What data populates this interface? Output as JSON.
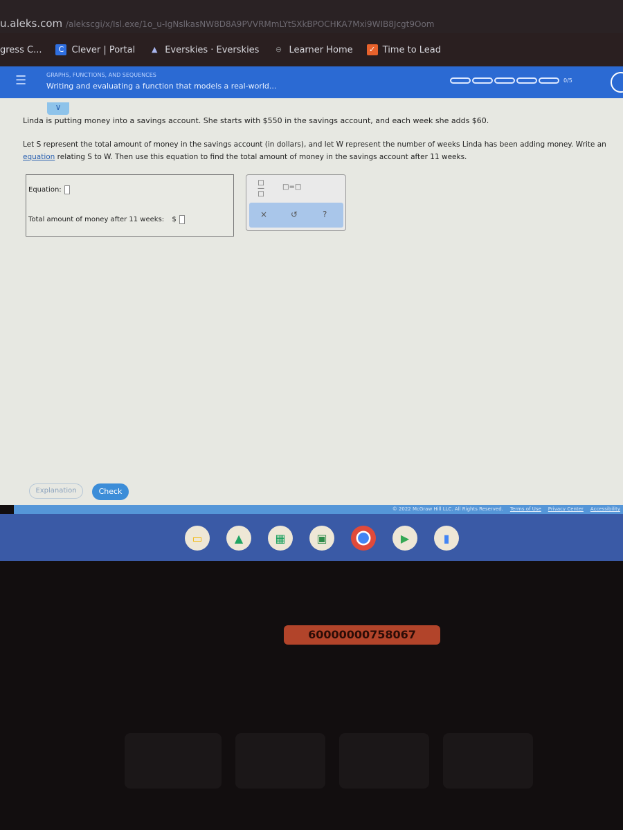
{
  "browser": {
    "url_domain": "u.aleks.com",
    "url_rest": "/alekscgi/x/Isl.exe/1o_u-IgNslkasNW8D8A9PVVRMmLYtSXkBPOCHKA7Mxi9WIB8Jcgt9Oom",
    "bookmarks": [
      {
        "label": "gress C...",
        "icon": "progress-icon"
      },
      {
        "label": "Clever | Portal",
        "icon": "clever-icon"
      },
      {
        "label": "Everskies · Everskies",
        "icon": "everskies-icon"
      },
      {
        "label": "Learner Home",
        "icon": "learner-home-icon"
      },
      {
        "label": "Time to Lead",
        "icon": "time-to-lead-icon"
      }
    ]
  },
  "header": {
    "topic": "GRAPHS, FUNCTIONS, AND SEQUENCES",
    "title": "Writing and evaluating a function that models a real-world...",
    "progress": {
      "done": 0,
      "total": 5,
      "label": "0/5"
    }
  },
  "problem": {
    "text1": "Linda is putting money into a savings account. She starts with $550 in the savings account, and each week she adds $60.",
    "text2a": "Let S represent the total amount of money in the savings account (in dollars), and let W represent the number of weeks Linda has been adding money. Write an",
    "link": "equation",
    "text2b": " relating S to W. Then use this equation to find the total amount of money in the savings account after 11 weeks."
  },
  "answers": {
    "equation_label": "Equation:",
    "equation_value": "",
    "total_label": "Total amount of money after 11 weeks:",
    "total_prefix": "$",
    "total_value": ""
  },
  "tools": {
    "fraction": "fraction-icon",
    "equals": "□=□",
    "clear": "×",
    "undo": "↺",
    "help": "?"
  },
  "buttons": {
    "explanation": "Explanation",
    "check": "Check"
  },
  "footer": {
    "copyright": "© 2022 McGraw Hill LLC. All Rights Reserved.",
    "terms": "Terms of Use",
    "privacy": "Privacy Center",
    "access": "Accessibility"
  },
  "shelf": [
    "slides-icon",
    "drive-icon",
    "sheets-icon",
    "classroom-icon",
    "chrome-icon",
    "play-store-icon",
    "docs-icon"
  ],
  "sticker": "60000000758067"
}
